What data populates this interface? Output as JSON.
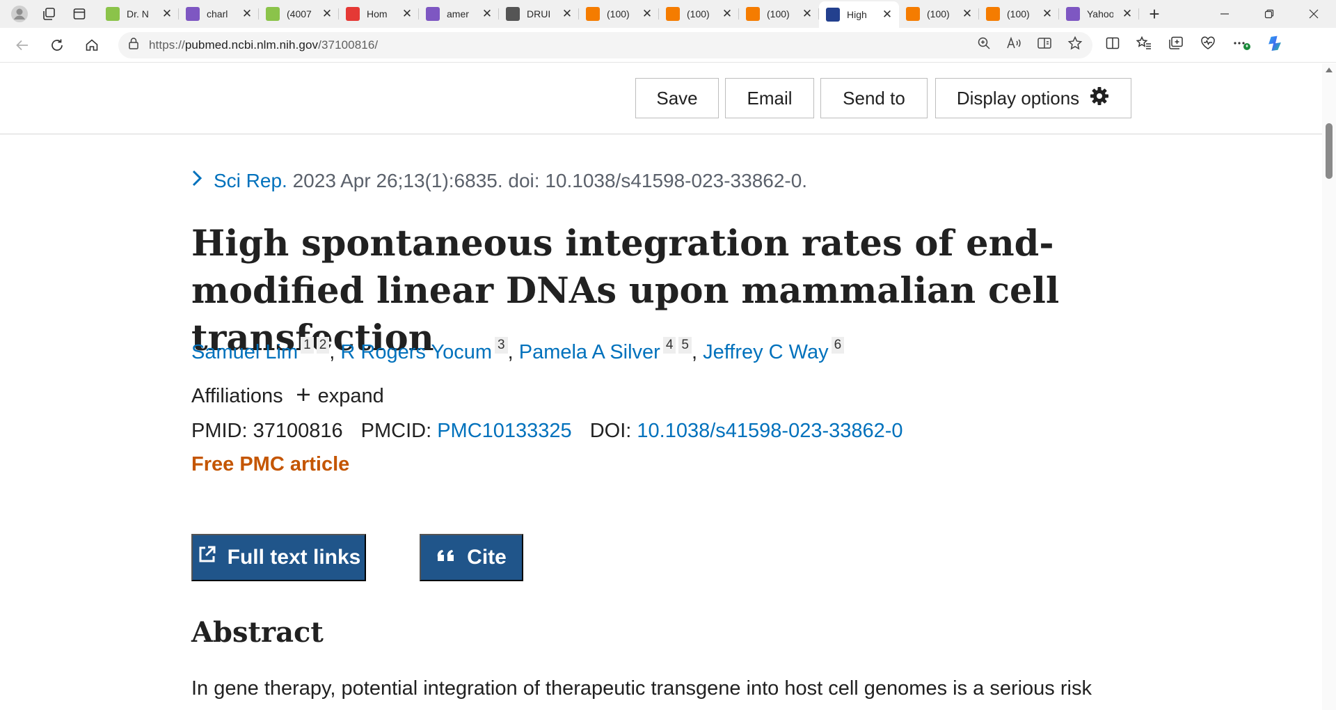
{
  "tabs": [
    {
      "title": "Dr. N",
      "favicon": "play-icon",
      "color": "#8bc34a",
      "active": false
    },
    {
      "title": "charl",
      "favicon": "yahoo-icon",
      "color": "#7e57c2",
      "active": false
    },
    {
      "title": "(4007",
      "favicon": "g-icon",
      "color": "#8bc34a",
      "active": false
    },
    {
      "title": "Hom",
      "favicon": "podcast-icon",
      "color": "#e53935",
      "active": false
    },
    {
      "title": "amer",
      "favicon": "yahoo-icon",
      "color": "#7e57c2",
      "active": false
    },
    {
      "title": "DRUI",
      "favicon": "dr-icon",
      "color": "#555555",
      "active": false
    },
    {
      "title": "(100)",
      "favicon": "bookmark-icon",
      "color": "#f57c00",
      "active": false
    },
    {
      "title": "(100)",
      "favicon": "bookmark-icon",
      "color": "#f57c00",
      "active": false
    },
    {
      "title": "(100)",
      "favicon": "bookmark-icon",
      "color": "#f57c00",
      "active": false
    },
    {
      "title": "High",
      "favicon": "pubmed-icon",
      "color": "#23408e",
      "active": true
    },
    {
      "title": "(100)",
      "favicon": "bookmark-icon",
      "color": "#f57c00",
      "active": false
    },
    {
      "title": "(100)",
      "favicon": "bookmark-icon",
      "color": "#f57c00",
      "active": false
    },
    {
      "title": "Yahoo",
      "favicon": "yahoo-icon",
      "color": "#7e57c2",
      "active": false
    }
  ],
  "address": {
    "scheme": "https://",
    "host": "pubmed.ncbi.nlm.nih.gov",
    "path": "/37100816/"
  },
  "actions": {
    "save": "Save",
    "email": "Email",
    "send_to": "Send to",
    "display_options": "Display options"
  },
  "article": {
    "journal": "Sci Rep.",
    "citation": "2023 Apr 26;13(1):6835. doi: 10.1038/s41598-023-33862-0.",
    "title": "High spontaneous integration rates of end-modified linear DNAs upon mammalian cell transfection",
    "authors": [
      {
        "name": "Samuel Lim",
        "affs": [
          "1",
          "2"
        ]
      },
      {
        "name": "R Rogers Yocum",
        "affs": [
          "3"
        ]
      },
      {
        "name": "Pamela A Silver",
        "affs": [
          "4",
          "5"
        ]
      },
      {
        "name": "Jeffrey C Way",
        "affs": [
          "6"
        ]
      }
    ],
    "affiliations_label": "Affiliations",
    "expand_label": "expand",
    "pmid_label": "PMID:",
    "pmid": "37100816",
    "pmcid_label": "PMCID:",
    "pmcid": "PMC10133325",
    "doi_label": "DOI:",
    "doi": "10.1038/s41598-023-33862-0",
    "free_pmc": "Free PMC article",
    "full_text_links": "Full text links",
    "cite": "Cite",
    "abstract_heading": "Abstract",
    "abstract_first_line": "In gene therapy, potential integration of therapeutic transgene into host cell genomes is a serious risk"
  },
  "colors": {
    "link": "#0071bc",
    "button_primary": "#20558a",
    "free_pmc": "#c45500"
  }
}
